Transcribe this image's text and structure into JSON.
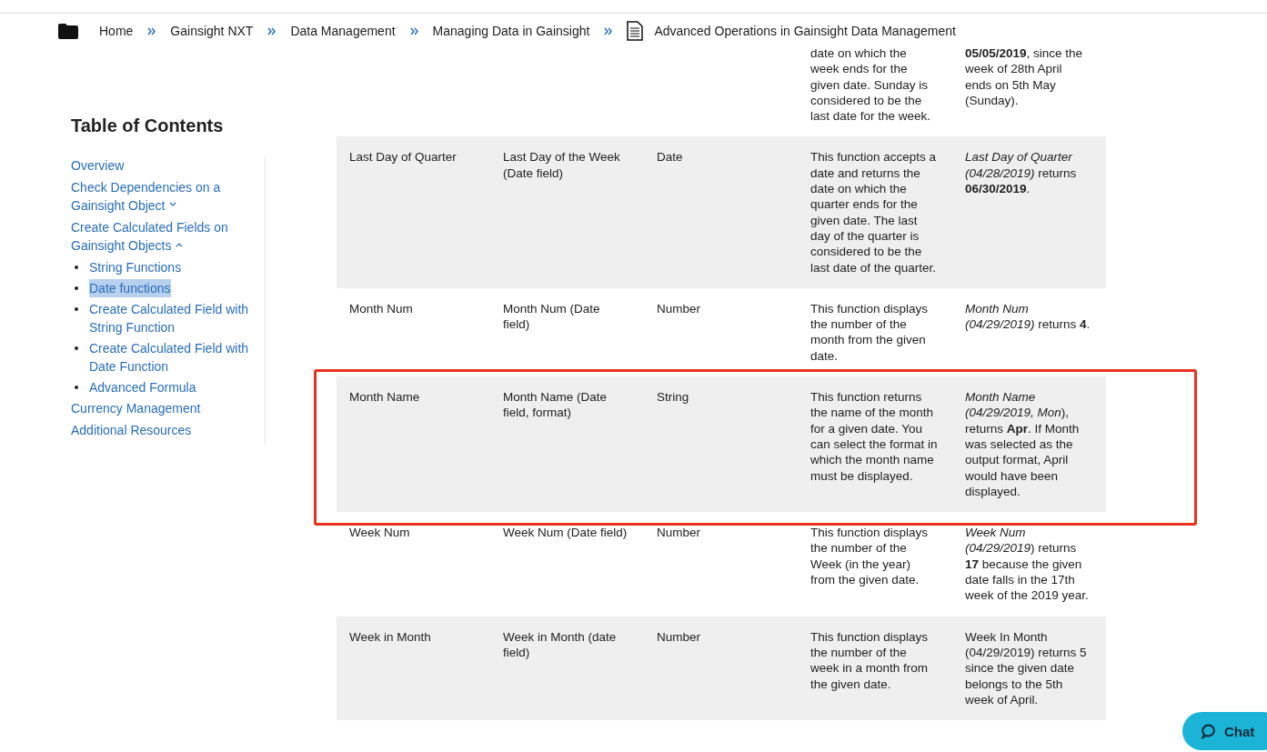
{
  "breadcrumb": [
    {
      "label": "Home",
      "kind": "link"
    },
    {
      "label": "Gainsight NXT",
      "kind": "link"
    },
    {
      "label": "Data Management",
      "kind": "link"
    },
    {
      "label": "Managing Data in Gainsight",
      "kind": "link"
    },
    {
      "label": "Advanced Operations in Gainsight Data Management",
      "kind": "page"
    }
  ],
  "toc": {
    "title": "Table of Contents",
    "items": [
      {
        "label": "Overview",
        "selected": false
      },
      {
        "label": "Check Dependencies on a Gainsight Object",
        "selected": false,
        "expanded": false
      },
      {
        "label": "Create Calculated Fields on Gainsight Objects",
        "selected": false,
        "expanded": true,
        "children": [
          {
            "label": "String Functions",
            "selected": false
          },
          {
            "label": "Date functions",
            "selected": true
          },
          {
            "label": "Create Calculated Field with String Function",
            "selected": false
          },
          {
            "label": "Create Calculated Field with Date Function",
            "selected": false
          },
          {
            "label": "Advanced Formula",
            "selected": false
          }
        ]
      },
      {
        "label": "Currency Management",
        "selected": false
      },
      {
        "label": "Additional Resources",
        "selected": false
      }
    ]
  },
  "table": {
    "rows": [
      {
        "description": "date on which the week ends for the given date. Sunday is considered to be the last date for the week.",
        "example": "**05/05/2019**, since the week of 28th April ends on 5th May (Sunday).",
        "highlighted": false
      },
      {
        "name": "Last Day of Quarter",
        "syntax": "Last Day of the Week (Date field)",
        "type": "Date",
        "description": "This function accepts a date and returns the date on which the quarter ends for the given date. The last day of the quarter is considered to be the last date of the quarter.",
        "example": "*Last Day of Quarter (04/28/2019)* returns **06/30/2019**.",
        "highlighted": false
      },
      {
        "name": "Month Num",
        "syntax": "Month Num (Date field)",
        "type": "Number",
        "description": "This function displays the number of the month from the given date.",
        "example": "*Month Num (04/29/2019)* returns **4**.",
        "highlighted": false
      },
      {
        "name": "Month Name",
        "syntax": "Month Name (Date field, format)",
        "type": "String",
        "description": "This function returns the name of the month for a given date. You can select the format in which the month name must be displayed.",
        "example": "*Month Name (04/29/2019, Mon*), returns **Apr**. If Month was selected as the output format, April would have been displayed.",
        "highlighted": true
      },
      {
        "name": "Week Num",
        "syntax": "Week Num (Date field)",
        "type": "Number",
        "description": "This function displays the number of the Week (in the year) from the given date.",
        "example": "*Week Num (04/29/2019*) returns **17** because the given date falls in the 17th week of the 2019 year.",
        "highlighted": false
      },
      {
        "name": "Week in Month",
        "syntax": "Week in Month (date field)",
        "type": "Number",
        "description": "This function displays the number of the week in a month from the given date.",
        "example": "Week In Month (04/29/2019) returns 5 since the given date belongs to the 5th week of April.",
        "highlighted": false
      }
    ]
  },
  "chat": {
    "label": "Chat"
  }
}
